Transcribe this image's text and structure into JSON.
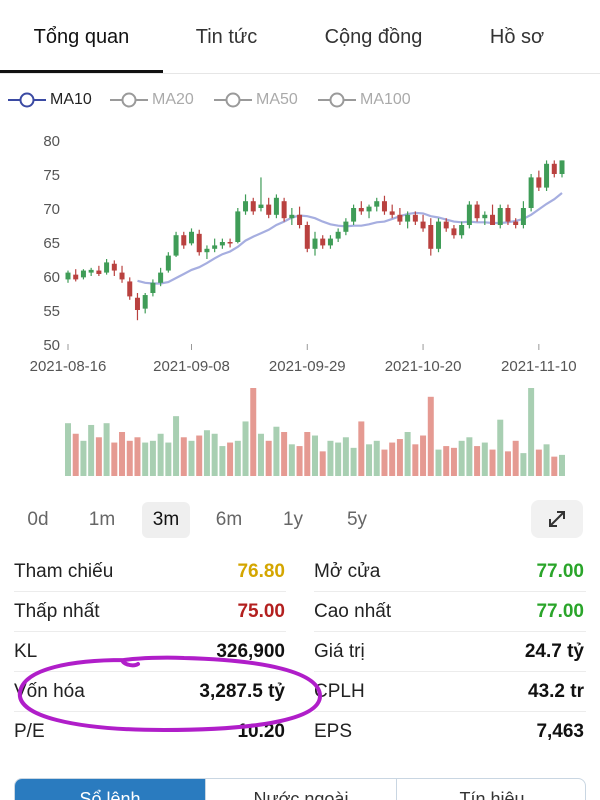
{
  "tabs": [
    {
      "label": "Tổng quan",
      "active": true
    },
    {
      "label": "Tin tức",
      "active": false
    },
    {
      "label": "Cộng đồng",
      "active": false
    },
    {
      "label": "Hồ sơ",
      "active": false
    }
  ],
  "ma_legend": [
    {
      "label": "MA10",
      "active": true
    },
    {
      "label": "MA20",
      "active": false
    },
    {
      "label": "MA50",
      "active": false
    },
    {
      "label": "MA100",
      "active": false
    }
  ],
  "ranges": [
    {
      "label": "0d",
      "active": false
    },
    {
      "label": "1m",
      "active": false
    },
    {
      "label": "3m",
      "active": true
    },
    {
      "label": "6m",
      "active": false
    },
    {
      "label": "1y",
      "active": false
    },
    {
      "label": "5y",
      "active": false
    }
  ],
  "expand_icon": "expand-arrows-icon",
  "stats": {
    "left": [
      {
        "label": "Tham chiếu",
        "value": "76.80",
        "color": "#d4a600"
      },
      {
        "label": "Thấp nhất",
        "value": "75.00",
        "color": "#b3201f"
      },
      {
        "label": "KL",
        "value": "326,900",
        "color": "#111111"
      },
      {
        "label": "Vốn hóa",
        "value": "3,287.5 tỷ",
        "color": "#111111"
      },
      {
        "label": "P/E",
        "value": "10.20",
        "color": "#111111"
      }
    ],
    "right": [
      {
        "label": "Mở cửa",
        "value": "77.00",
        "color": "#2aa52a"
      },
      {
        "label": "Cao nhất",
        "value": "77.00",
        "color": "#2aa52a"
      },
      {
        "label": "Giá trị",
        "value": "24.7 tỷ",
        "color": "#111111"
      },
      {
        "label": "CPLH",
        "value": "43.2 tr",
        "color": "#111111"
      },
      {
        "label": "EPS",
        "value": "7,463",
        "color": "#111111"
      }
    ]
  },
  "bottom_tabs": [
    {
      "label": "Sổ lệnh",
      "active": true
    },
    {
      "label": "Nước ngoài",
      "active": false
    },
    {
      "label": "Tín hiệu",
      "active": false
    }
  ],
  "colors": {
    "up": "#3f9c57",
    "down": "#b9413f",
    "vol_up": "#a8cfb2",
    "vol_down": "#e59a92",
    "ma_line": "#a6aee0",
    "ma_active": "#3b4aa3",
    "highlight": "#b01ec9"
  },
  "chart_data": {
    "type": "candlestick",
    "ylim": [
      50,
      80
    ],
    "yticks": [
      50,
      55,
      60,
      65,
      70,
      75,
      80
    ],
    "x_tick_labels": [
      "2021-08-16",
      "2021-09-08",
      "2021-09-29",
      "2021-10-20",
      "2021-11-10"
    ],
    "x_tick_index": [
      0,
      16,
      31,
      46,
      61
    ],
    "candles": [
      [
        59.5,
        60.8,
        59.0,
        60.5
      ],
      [
        60.2,
        61.0,
        59.2,
        59.5
      ],
      [
        59.8,
        61.0,
        59.5,
        60.8
      ],
      [
        60.5,
        61.2,
        60.0,
        60.9
      ],
      [
        60.8,
        61.5,
        60.0,
        60.3
      ],
      [
        60.5,
        62.5,
        60.2,
        62.0
      ],
      [
        61.8,
        62.3,
        60.0,
        60.8
      ],
      [
        60.5,
        61.5,
        59.0,
        59.5
      ],
      [
        59.2,
        59.8,
        56.5,
        57.0
      ],
      [
        56.8,
        57.5,
        53.5,
        55.0
      ],
      [
        55.2,
        57.5,
        54.5,
        57.2
      ],
      [
        57.5,
        59.5,
        57.0,
        59.0
      ],
      [
        59.0,
        61.2,
        58.5,
        60.5
      ],
      [
        60.8,
        63.5,
        60.5,
        63.0
      ],
      [
        63.0,
        66.5,
        62.8,
        66.0
      ],
      [
        66.0,
        66.5,
        64.0,
        64.5
      ],
      [
        64.8,
        67.0,
        64.5,
        66.5
      ],
      [
        66.2,
        66.8,
        63.0,
        63.5
      ],
      [
        63.5,
        64.5,
        62.5,
        64.0
      ],
      [
        64.0,
        65.5,
        63.5,
        64.5
      ],
      [
        64.5,
        65.5,
        64.0,
        65.0
      ],
      [
        65.0,
        65.5,
        64.2,
        64.8
      ],
      [
        65.0,
        70.0,
        64.8,
        69.5
      ],
      [
        69.5,
        72.0,
        69.0,
        71.0
      ],
      [
        71.0,
        71.5,
        69.0,
        69.5
      ],
      [
        70.0,
        74.5,
        69.5,
        70.5
      ],
      [
        70.5,
        71.5,
        68.5,
        69.0
      ],
      [
        69.0,
        72.0,
        68.5,
        71.5
      ],
      [
        71.0,
        71.5,
        68.0,
        68.5
      ],
      [
        68.5,
        70.0,
        67.5,
        69.0
      ],
      [
        69.0,
        70.2,
        67.0,
        67.5
      ],
      [
        67.5,
        68.0,
        63.5,
        64.0
      ],
      [
        64.0,
        66.5,
        63.0,
        65.5
      ],
      [
        65.5,
        66.0,
        64.0,
        64.5
      ],
      [
        64.5,
        66.0,
        64.0,
        65.5
      ],
      [
        65.5,
        67.0,
        65.0,
        66.5
      ],
      [
        66.5,
        68.5,
        66.0,
        68.0
      ],
      [
        68.0,
        70.5,
        67.5,
        70.0
      ],
      [
        70.0,
        71.0,
        69.0,
        69.5
      ],
      [
        69.5,
        70.5,
        68.5,
        70.2
      ],
      [
        70.2,
        71.5,
        69.5,
        71.0
      ],
      [
        71.0,
        71.8,
        69.0,
        69.5
      ],
      [
        69.5,
        70.5,
        68.5,
        69.0
      ],
      [
        69.0,
        70.0,
        67.5,
        68.0
      ],
      [
        68.0,
        69.5,
        67.0,
        69.0
      ],
      [
        69.0,
        69.5,
        67.5,
        68.0
      ],
      [
        68.0,
        69.0,
        66.5,
        67.0
      ],
      [
        67.5,
        68.5,
        63.0,
        64.0
      ],
      [
        64.0,
        68.5,
        63.5,
        68.0
      ],
      [
        68.0,
        68.5,
        66.5,
        67.0
      ],
      [
        67.0,
        67.5,
        65.5,
        66.0
      ],
      [
        66.0,
        68.0,
        65.5,
        67.5
      ],
      [
        67.5,
        71.0,
        67.0,
        70.5
      ],
      [
        70.5,
        71.0,
        68.0,
        68.5
      ],
      [
        68.5,
        69.5,
        67.5,
        69.0
      ],
      [
        69.0,
        70.5,
        68.0,
        67.5
      ],
      [
        67.5,
        70.5,
        67.0,
        70.0
      ],
      [
        70.0,
        70.5,
        67.5,
        68.0
      ],
      [
        68.0,
        68.5,
        67.0,
        67.5
      ],
      [
        67.5,
        71.0,
        67.0,
        70.0
      ],
      [
        70.0,
        75.0,
        69.5,
        74.5
      ],
      [
        74.5,
        75.5,
        72.5,
        73.0
      ],
      [
        73.0,
        77.0,
        72.5,
        76.5
      ],
      [
        76.5,
        77.0,
        74.5,
        75.0
      ],
      [
        75.0,
        77.0,
        74.5,
        77.0
      ]
    ],
    "ma10": [
      null,
      null,
      null,
      null,
      null,
      null,
      null,
      null,
      null,
      59.3,
      59.0,
      58.9,
      58.9,
      59.1,
      59.7,
      60.3,
      60.9,
      61.3,
      61.9,
      62.6,
      63.2,
      63.6,
      64.3,
      65.2,
      65.8,
      66.3,
      66.8,
      67.5,
      68.0,
      68.6,
      68.9,
      68.8,
      68.5,
      68.0,
      67.6,
      67.4,
      67.3,
      67.4,
      67.4,
      67.6,
      67.9,
      68.0,
      68.4,
      68.8,
      69.1,
      69.3,
      69.2,
      68.8,
      68.6,
      68.3,
      68.0,
      67.9,
      68.0,
      67.9,
      67.9,
      67.8,
      67.8,
      67.9,
      68.1,
      68.4,
      69.0,
      69.8,
      70.6,
      71.3,
      72.2
    ],
    "volume": [
      0.6,
      0.48,
      0.4,
      0.58,
      0.44,
      0.6,
      0.38,
      0.5,
      0.4,
      0.44,
      0.38,
      0.4,
      0.48,
      0.38,
      0.68,
      0.44,
      0.4,
      0.46,
      0.52,
      0.48,
      0.34,
      0.38,
      0.4,
      0.62,
      1.0,
      0.48,
      0.4,
      0.56,
      0.5,
      0.36,
      0.34,
      0.5,
      0.46,
      0.28,
      0.4,
      0.38,
      0.44,
      0.32,
      0.62,
      0.36,
      0.4,
      0.3,
      0.38,
      0.42,
      0.5,
      0.36,
      0.46,
      0.44,
      0.3,
      0.34,
      0.32,
      0.4,
      0.44,
      0.34,
      0.38,
      0.3,
      0.32,
      0.28,
      0.4,
      0.26,
      0.64,
      0.3,
      0.36,
      0.22,
      0.24
    ],
    "volume_extra_spikes": {
      "24": 1.0,
      "47": 0.9,
      "56": 0.64,
      "60": 1.0
    }
  }
}
